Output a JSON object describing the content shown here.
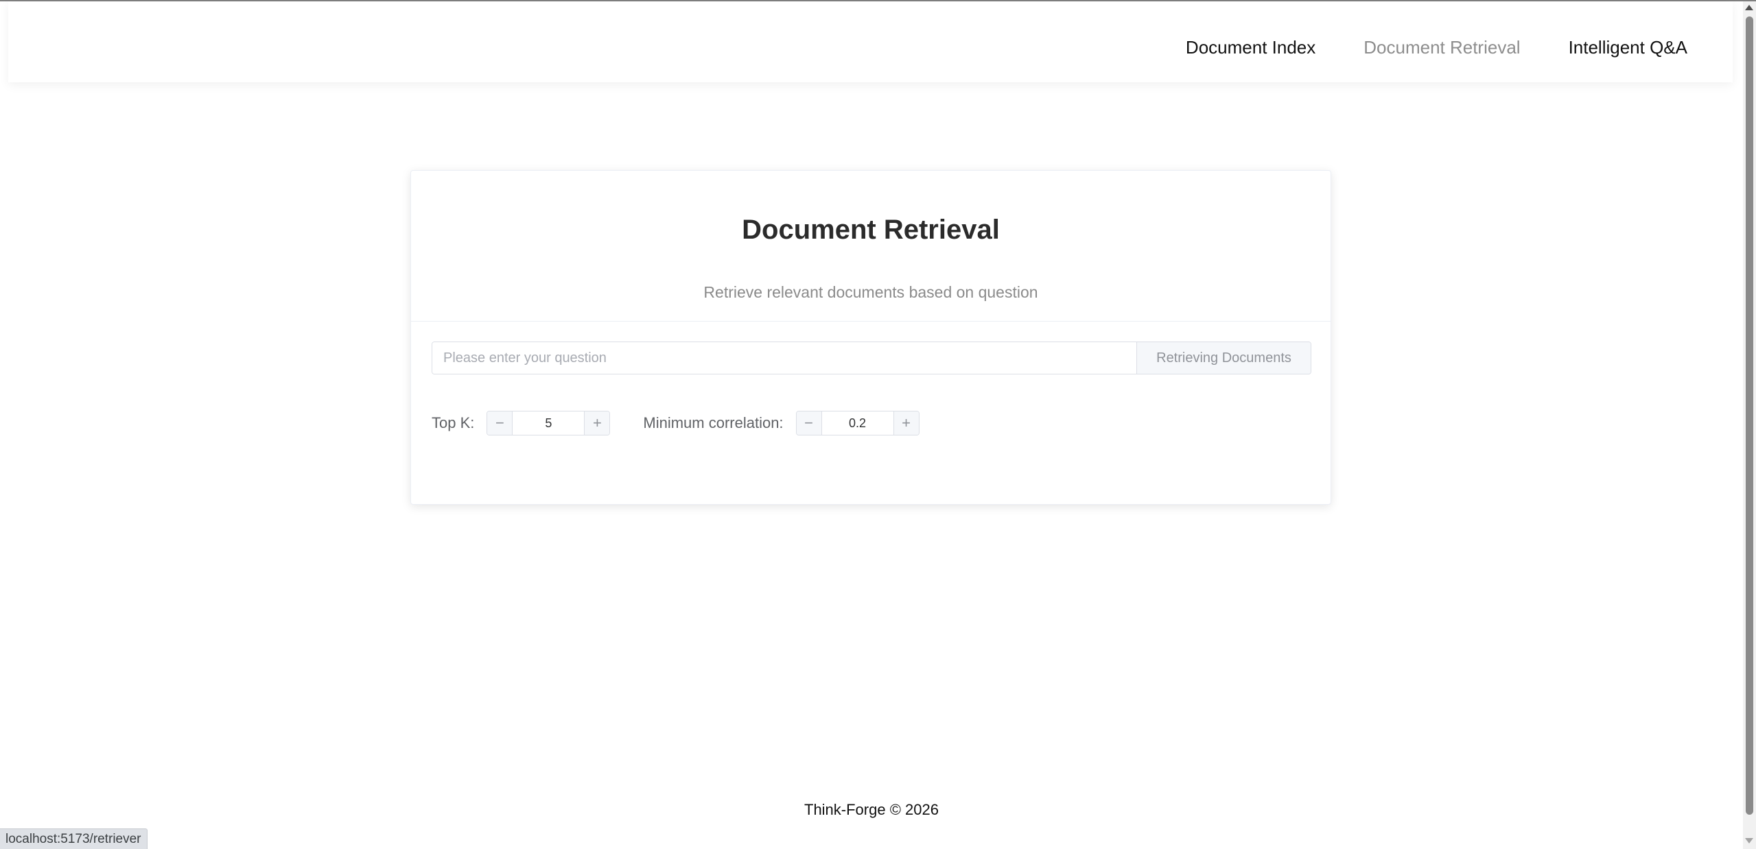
{
  "nav": {
    "items": [
      {
        "label": "Document Index"
      },
      {
        "label": "Document Retrieval"
      },
      {
        "label": "Intelligent Q&A"
      }
    ],
    "active_index": 1
  },
  "card": {
    "title": "Document Retrieval",
    "subtitle": "Retrieve relevant documents based on question",
    "search": {
      "placeholder": "Please enter your question",
      "value": "",
      "button_label": "Retrieving Documents"
    },
    "params": {
      "top_k": {
        "label": "Top K:",
        "value": "5",
        "minus": "−",
        "plus": "+"
      },
      "min_correlation": {
        "label": "Minimum correlation:",
        "value": "0.2",
        "minus": "−",
        "plus": "+"
      }
    }
  },
  "footer": {
    "text": "Think-Forge © 2026"
  },
  "status_bar": {
    "url": "localhost:5173/retriever"
  },
  "colors": {
    "active_nav": "#8d8d8d",
    "text": "#303133",
    "border": "#dcdfe6",
    "muted": "#909399"
  }
}
